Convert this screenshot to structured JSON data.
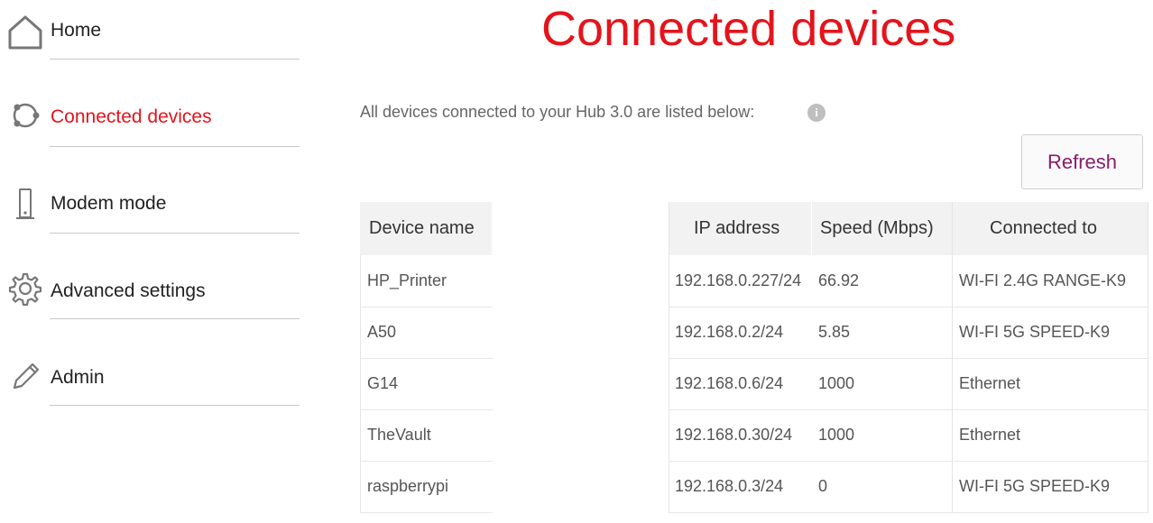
{
  "sidebar": {
    "items": [
      {
        "label": "Home",
        "icon": "home-icon",
        "active": false
      },
      {
        "label": "Connected devices",
        "icon": "connected-devices-icon",
        "active": true
      },
      {
        "label": "Modem mode",
        "icon": "modem-icon",
        "active": false
      },
      {
        "label": "Advanced settings",
        "icon": "gear-icon",
        "active": false
      },
      {
        "label": "Admin",
        "icon": "pencil-icon",
        "active": false
      }
    ]
  },
  "main": {
    "title": "Connected devices",
    "intro": "All devices connected to your Hub 3.0 are listed below:",
    "info_icon": "i",
    "refresh_label": "Refresh"
  },
  "table": {
    "headers": [
      "Device name",
      "IP address",
      "Speed (Mbps)",
      "Connected to"
    ],
    "rows": [
      [
        "HP_Printer",
        "192.168.0.227/24",
        "66.92",
        "WI-FI 2.4G RANGE-K9"
      ],
      [
        "A50",
        "192.168.0.2/24",
        "5.85",
        "WI-FI 5G SPEED-K9"
      ],
      [
        "G14",
        "192.168.0.6/24",
        "1000",
        "Ethernet"
      ],
      [
        "TheVault",
        "192.168.0.30/24",
        "1000",
        "Ethernet"
      ],
      [
        "raspberrypi",
        "192.168.0.3/24",
        "0",
        "WI-FI 5G SPEED-K9"
      ]
    ]
  },
  "colors": {
    "accent": "#e4141c",
    "button_text": "#8a1c6a",
    "header_bg": "#f2f2f2"
  }
}
